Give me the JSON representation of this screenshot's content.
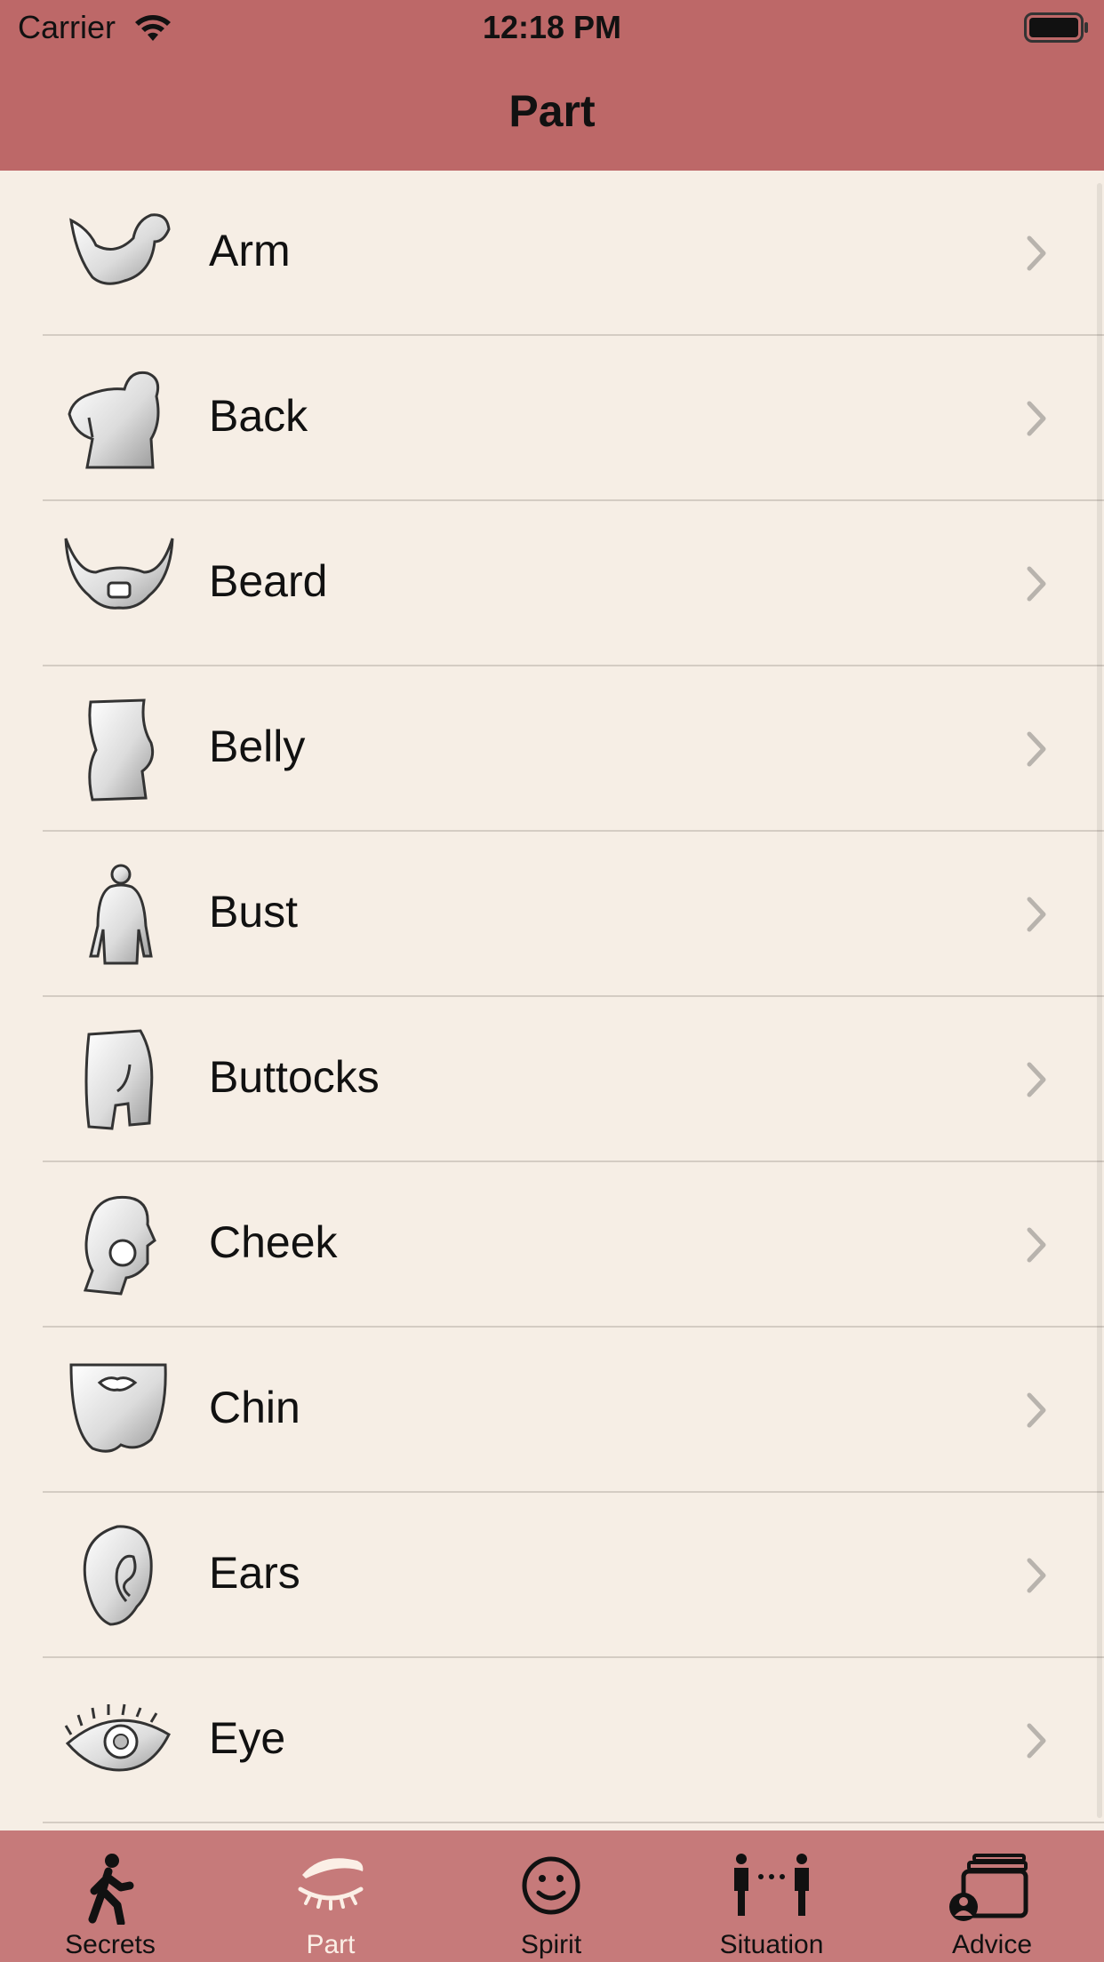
{
  "status_bar": {
    "carrier": "Carrier",
    "time": "12:18 PM"
  },
  "nav": {
    "title": "Part"
  },
  "list": {
    "items": [
      {
        "label": "Arm",
        "icon": "arm-icon"
      },
      {
        "label": "Back",
        "icon": "back-icon"
      },
      {
        "label": "Beard",
        "icon": "beard-icon"
      },
      {
        "label": "Belly",
        "icon": "belly-icon"
      },
      {
        "label": "Bust",
        "icon": "bust-icon"
      },
      {
        "label": "Buttocks",
        "icon": "buttocks-icon"
      },
      {
        "label": "Cheek",
        "icon": "cheek-icon"
      },
      {
        "label": "Chin",
        "icon": "chin-icon"
      },
      {
        "label": "Ears",
        "icon": "ear-icon"
      },
      {
        "label": "Eye",
        "icon": "eye-icon"
      }
    ]
  },
  "tabbar": {
    "tabs": [
      {
        "label": "Secrets",
        "icon": "walking-person-icon"
      },
      {
        "label": "Part",
        "icon": "eyelash-icon",
        "active": true
      },
      {
        "label": "Spirit",
        "icon": "smiley-icon"
      },
      {
        "label": "Situation",
        "icon": "two-people-icon"
      },
      {
        "label": "Advice",
        "icon": "cards-person-icon"
      }
    ]
  },
  "colors": {
    "header": "#bd6868",
    "background": "#f6eee5",
    "tabbar": "#c67a7a",
    "active_tab": "#fbefe6"
  }
}
